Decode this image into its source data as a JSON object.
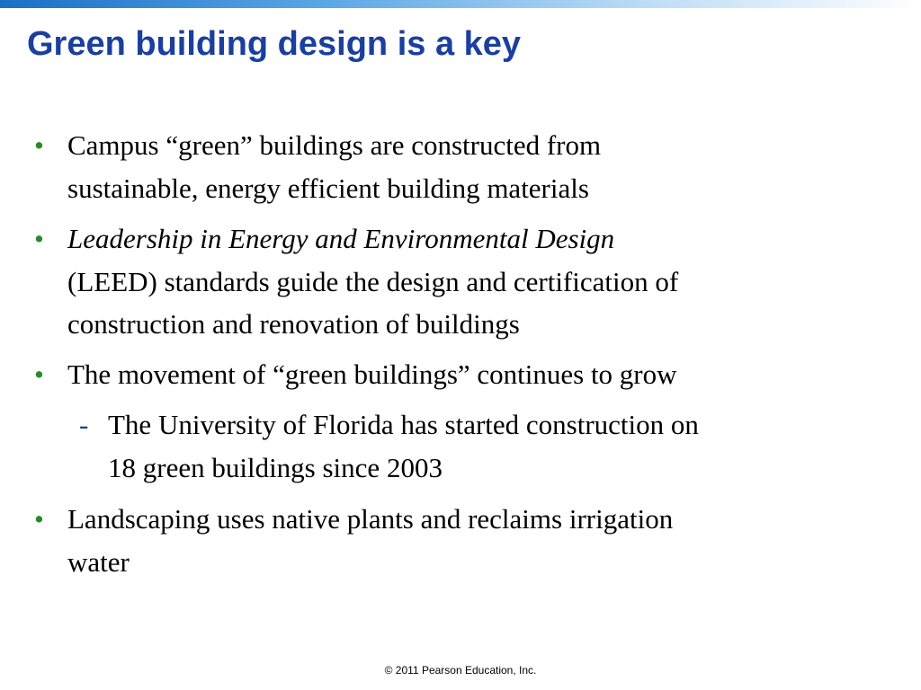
{
  "slide": {
    "title": "Green building design is a key",
    "bullet_symbol": "•",
    "sub_symbol": "-",
    "bullets": [
      {
        "lines": [
          "Campus “green” buildings are constructed from",
          "sustainable, energy efficient building materials"
        ]
      },
      {
        "lines": [
          "Leadership in Energy and Environmental Design",
          "(LEED) standards guide the design and certification of",
          "construction and renovation of buildings"
        ]
      },
      {
        "lines": [
          "The movement of “green buildings” continues to grow"
        ],
        "sub": {
          "lines": [
            "The University of Florida has started construction on",
            "18 green buildings since 2003"
          ]
        }
      },
      {
        "lines": [
          "Landscaping uses native plants and reclaims irrigation",
          "water"
        ]
      }
    ],
    "footer": "© 2011 Pearson Education, Inc.",
    "colors": {
      "title": "#1a3f9e",
      "bullet": "#2a8a2a",
      "text": "#000000"
    }
  }
}
